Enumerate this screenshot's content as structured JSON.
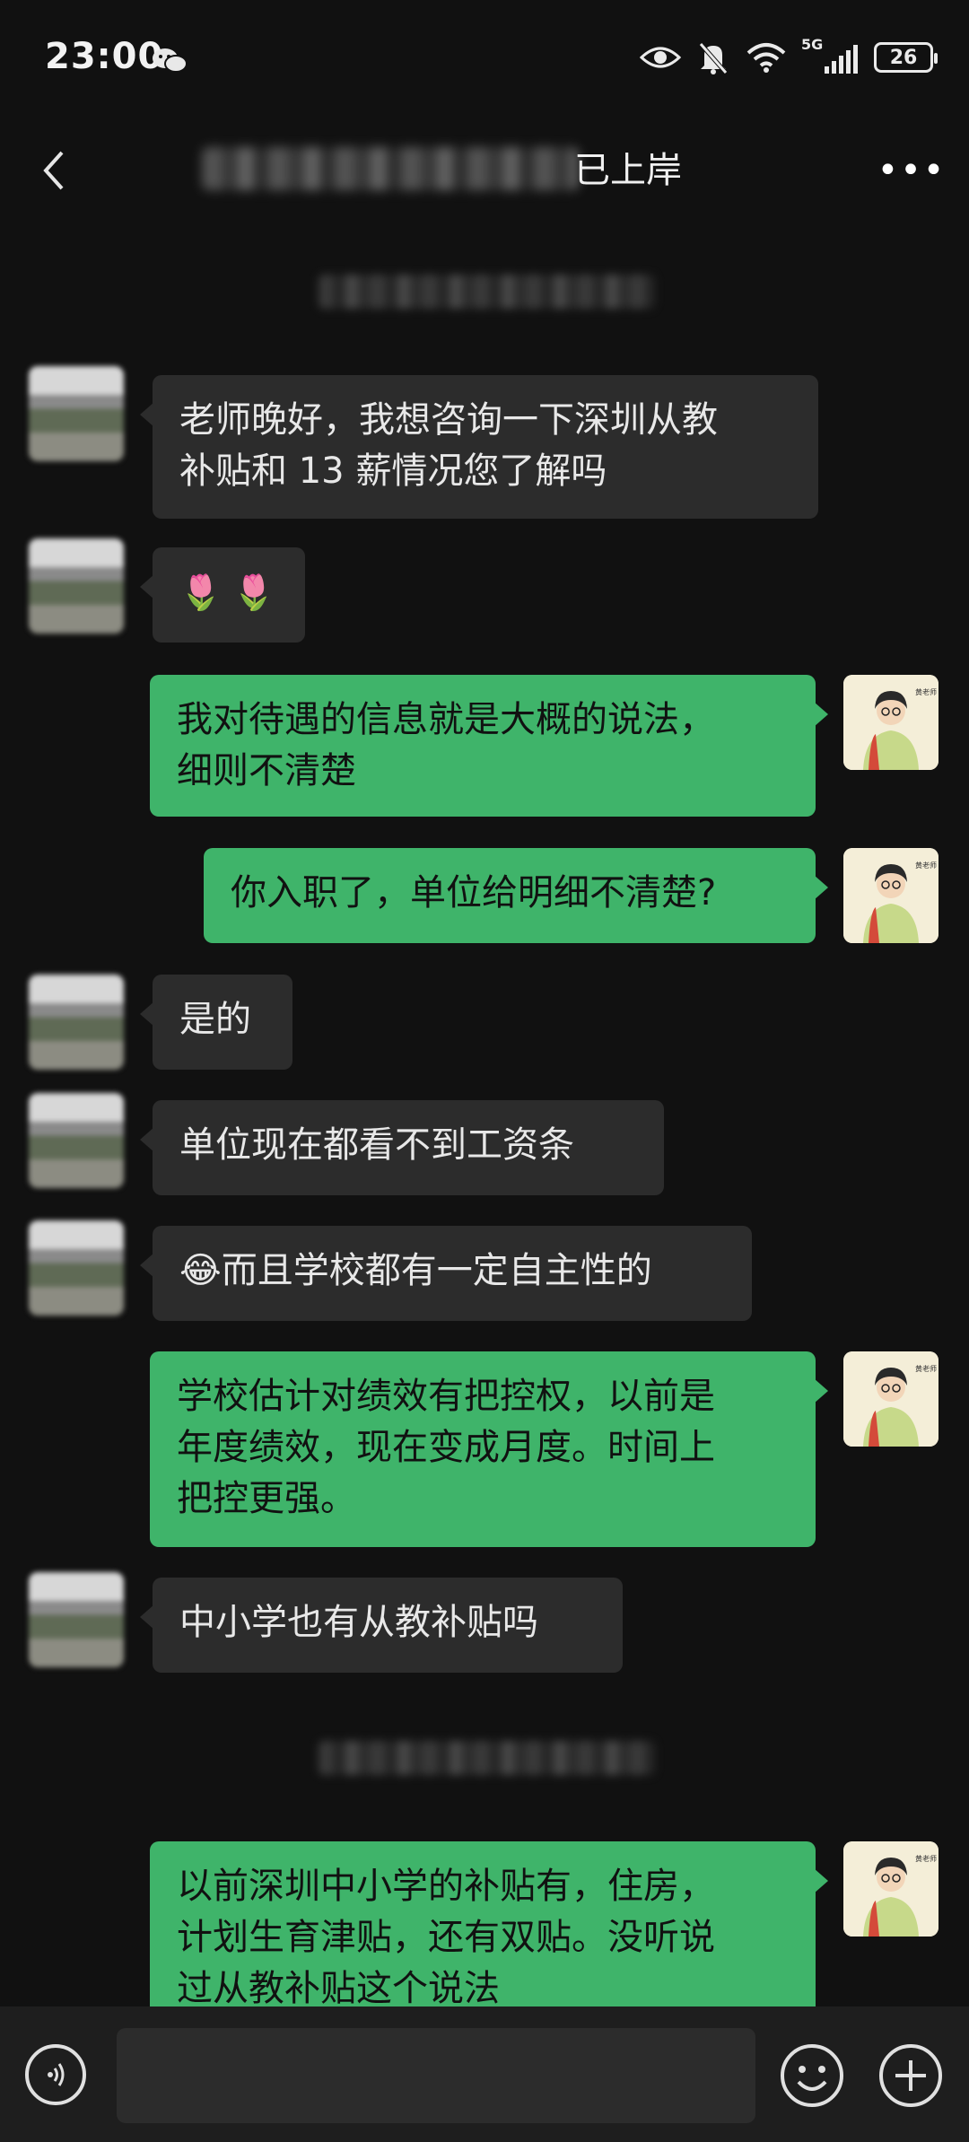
{
  "status_bar": {
    "time": "23:00",
    "network": "5G",
    "battery": "26"
  },
  "header": {
    "title_visible": "已上岸"
  },
  "messages": [
    {
      "side": "left",
      "text": "老师晚好，我想咨询一下深圳从教\n补贴和 13 薪情况您了解吗"
    },
    {
      "side": "left",
      "text": "🌷 🌷"
    },
    {
      "side": "right",
      "text": "我对待遇的信息就是大概的说法，\n细则不清楚"
    },
    {
      "side": "right",
      "text": "你入职了，单位给明细不清楚?"
    },
    {
      "side": "left",
      "text": "是的"
    },
    {
      "side": "left",
      "text": "单位现在都看不到工资条"
    },
    {
      "side": "left",
      "text": "😂而且学校都有一定自主性的"
    },
    {
      "side": "right",
      "text": "学校估计对绩效有把控权，以前是\n年度绩效，现在变成月度。时间上\n把控更强。"
    },
    {
      "side": "left",
      "text": "中小学也有从教补贴吗"
    },
    {
      "side": "right",
      "text": "以前深圳中小学的补贴有，住房，\n计划生育津贴，还有双贴。没听说\n过从教补贴这个说法"
    }
  ],
  "input_bar": {
    "placeholder": ""
  },
  "icons": {
    "back": "chevron-left-icon",
    "more": "more-icon",
    "voice": "voice-icon",
    "emoji": "emoji-icon",
    "plus": "plus-icon"
  },
  "colors": {
    "background": "#111111",
    "bubble_left": "#2c2c2c",
    "bubble_right": "#3fb46a"
  }
}
